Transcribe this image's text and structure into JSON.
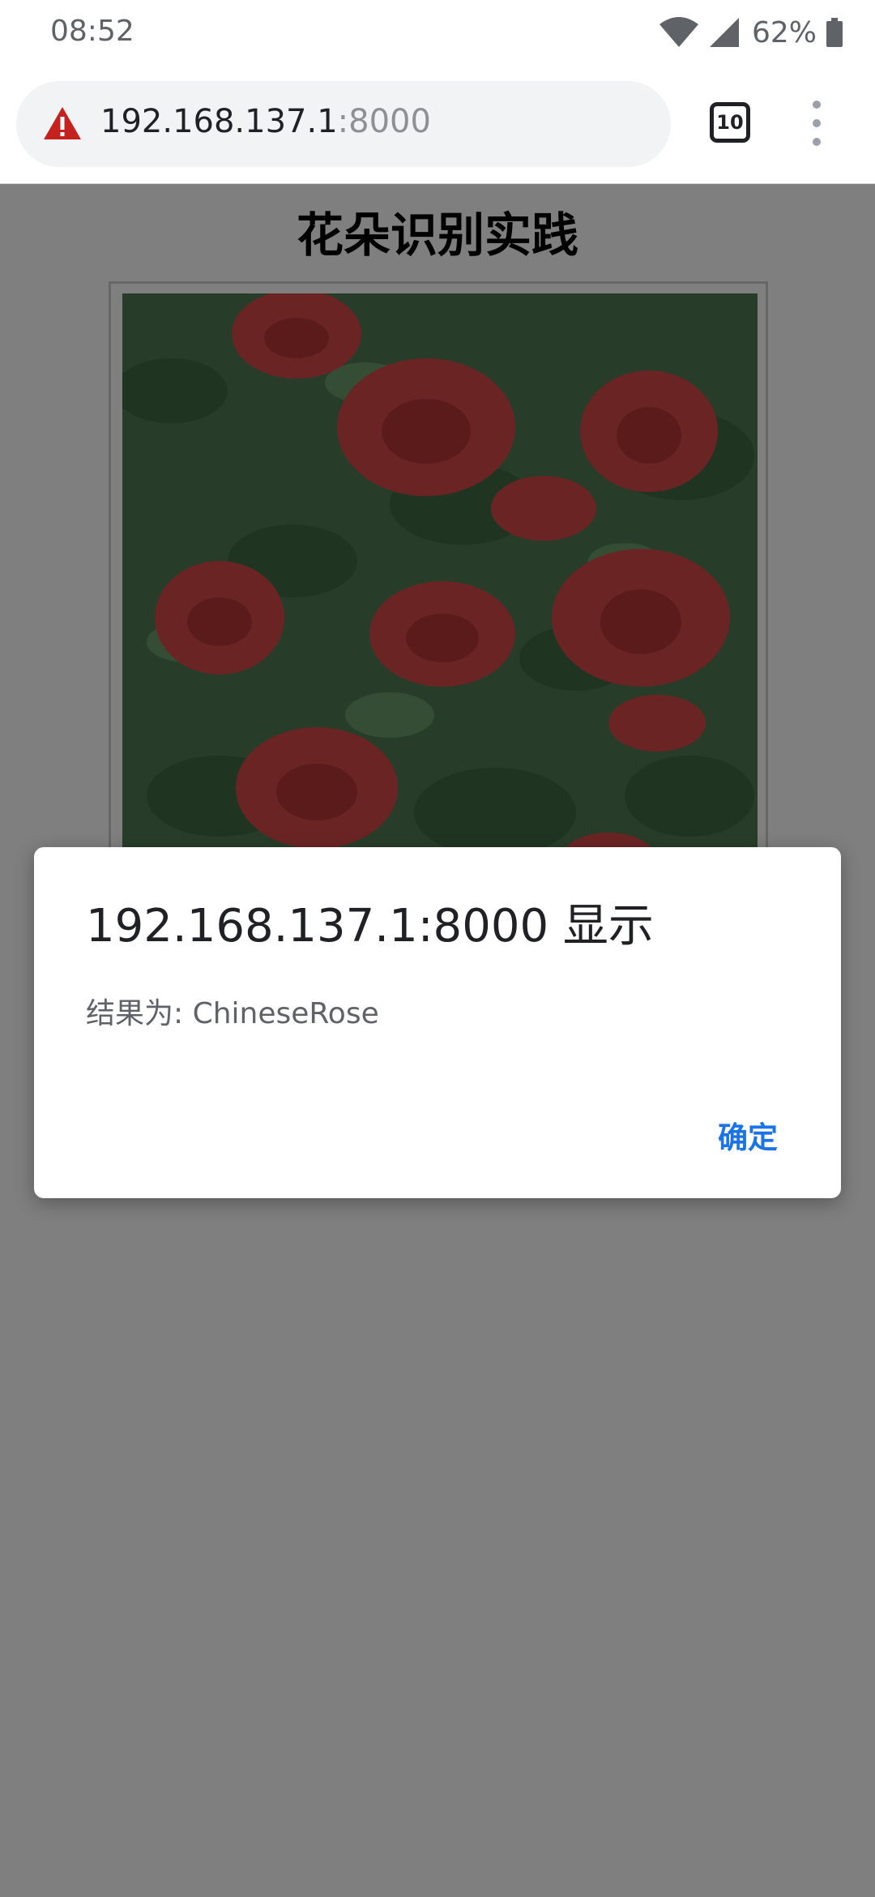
{
  "status_bar": {
    "time": "08:52",
    "battery_percent": "62%",
    "icons": [
      "wifi-icon",
      "signal-icon",
      "battery-icon"
    ]
  },
  "browser": {
    "url_host": "192.168.137.1",
    "url_port": ":8000",
    "tab_count": "10",
    "icons": [
      "warning-icon",
      "tab-switcher-icon",
      "menu-icon"
    ]
  },
  "page": {
    "title": "花朵识别实践"
  },
  "dialog": {
    "title": "192.168.137.1:8000 显示",
    "message": "结果为: ChineseRose",
    "ok_label": "确定"
  },
  "colors": {
    "link_blue": "#1a73e8",
    "warning_red": "#c5221f",
    "overlay": "rgba(0,0,0,0.5)"
  }
}
